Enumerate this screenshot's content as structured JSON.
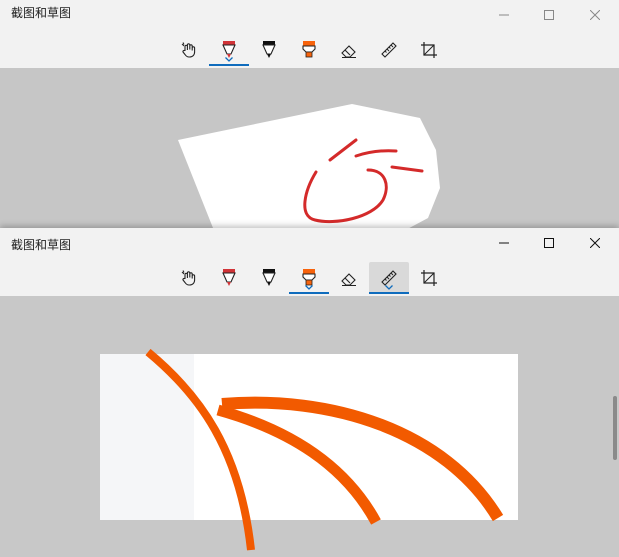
{
  "app": {
    "title": "截图和草图"
  },
  "window_top": {
    "tools": [
      {
        "name": "touch-writing-tool",
        "icon": "touch-writing-icon",
        "selected": false
      },
      {
        "name": "ballpoint-pen-tool",
        "icon": "ballpoint-pen-icon",
        "selected": true,
        "color": "#d13438"
      },
      {
        "name": "pencil-tool",
        "icon": "pencil-icon",
        "selected": false
      },
      {
        "name": "highlighter-tool",
        "icon": "highlighter-icon",
        "selected": false,
        "color": "#f7630c"
      },
      {
        "name": "eraser-tool",
        "icon": "eraser-icon",
        "selected": false
      },
      {
        "name": "ruler-tool",
        "icon": "ruler-icon",
        "selected": false
      },
      {
        "name": "crop-tool",
        "icon": "crop-icon",
        "selected": false
      }
    ],
    "ink_color": "#d13438"
  },
  "window_bottom": {
    "tools": [
      {
        "name": "touch-writing-tool",
        "icon": "touch-writing-icon",
        "selected": false
      },
      {
        "name": "ballpoint-pen-tool",
        "icon": "ballpoint-pen-icon",
        "selected": false,
        "color": "#d13438"
      },
      {
        "name": "pencil-tool",
        "icon": "pencil-icon",
        "selected": false
      },
      {
        "name": "highlighter-tool",
        "icon": "highlighter-icon",
        "selected": true,
        "color": "#f7630c"
      },
      {
        "name": "eraser-tool",
        "icon": "eraser-icon",
        "selected": false
      },
      {
        "name": "ruler-tool",
        "icon": "ruler-icon",
        "selected": true,
        "pressed": true
      },
      {
        "name": "crop-tool",
        "icon": "crop-icon",
        "selected": false
      }
    ],
    "ink_color": "#f25a00"
  },
  "colors": {
    "accent": "#0f6cbd",
    "titlebar": "#f2f2f2",
    "canvas_bg": "#c8c8c8"
  }
}
